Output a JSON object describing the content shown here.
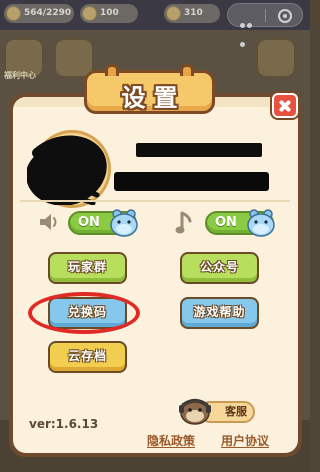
{
  "topbar": {
    "chip1_text": "564/2290",
    "chip2_text": "100",
    "chip3_text": "310"
  },
  "background": {
    "left_label": "福利中心"
  },
  "settings": {
    "title": "设置",
    "sound_toggle": "ON",
    "music_toggle": "ON",
    "buttons": {
      "player_group": "玩家群",
      "official_account": "公众号",
      "redeem_code": "兑换码",
      "game_help": "游戏帮助",
      "cloud_save": "云存档"
    },
    "service_label": "客服",
    "version": "ver:1.6.13",
    "privacy_policy": "隐私政策",
    "user_agreement": "用户协议"
  },
  "colors": {
    "frame": "#6e4b2e",
    "panel": "#fbf1dc",
    "title_plaque": "#f5c96a",
    "close": "#e8513f",
    "toggle_on": "#8acb43",
    "btn_yellow": "#f2ce50",
    "btn_green": "#b7de5c",
    "btn_blue": "#86c8ec",
    "annotation": "#e02a26"
  }
}
